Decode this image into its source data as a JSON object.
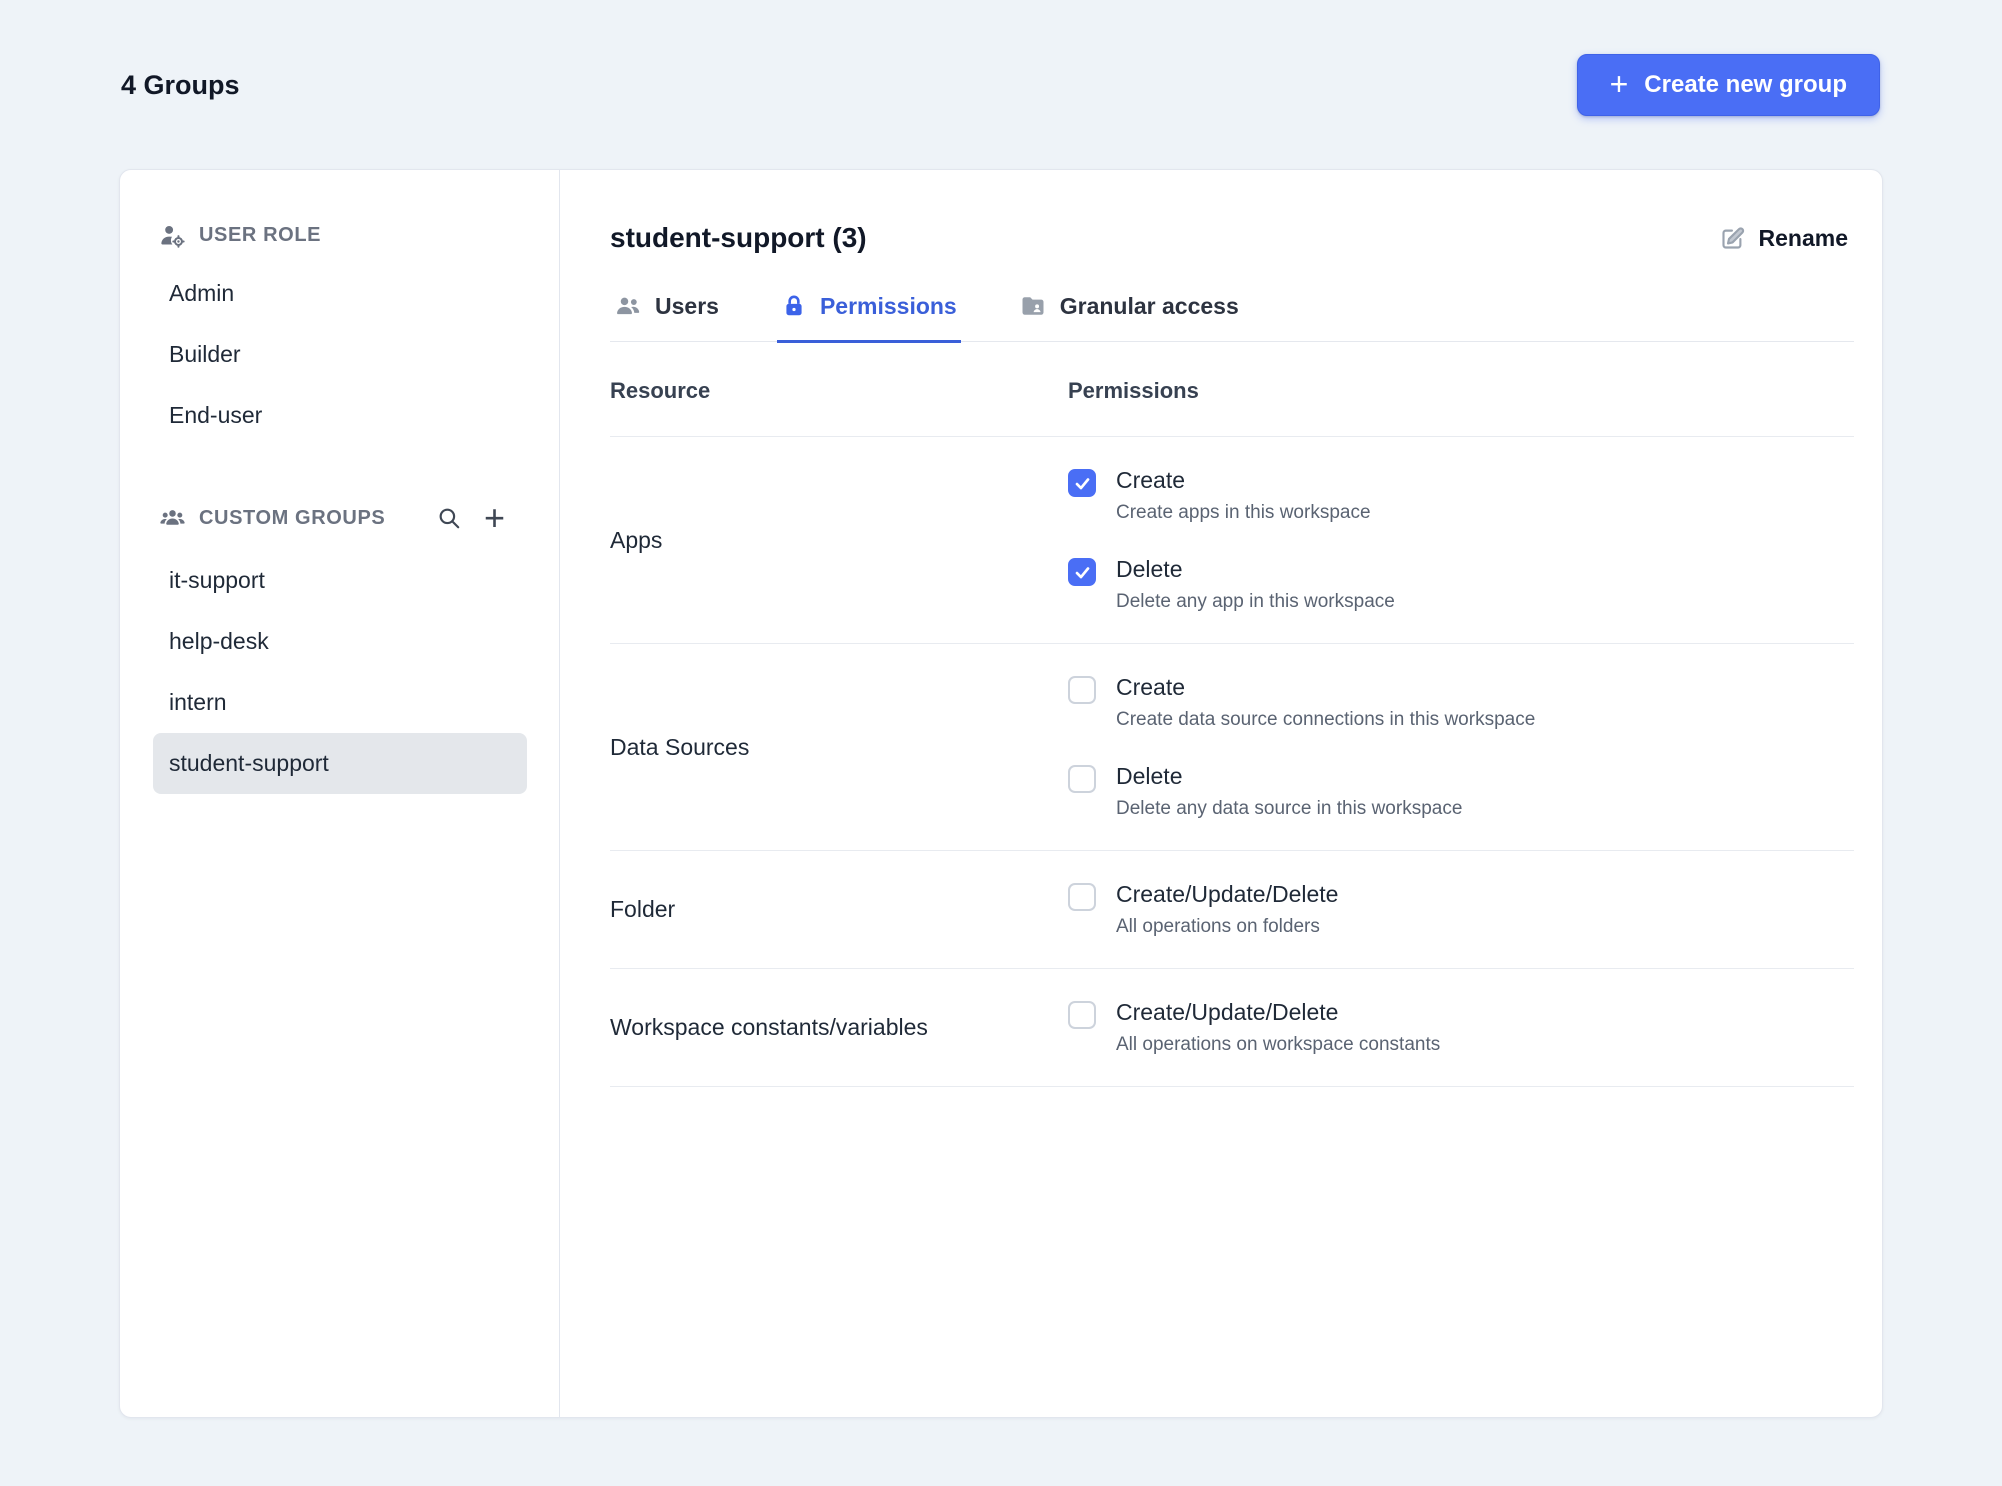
{
  "page": {
    "groups_label": "4 Groups",
    "create_button": "Create new group"
  },
  "icons": {
    "plus": "+"
  },
  "colors": {
    "accent": "#4a6ef5",
    "tab_active": "#3a5fd9",
    "checkbox_checked": "#4a6ef5",
    "page_background": "#eef3f8",
    "selected_item_background": "#e4e7eb"
  },
  "sidebar": {
    "user_role": {
      "title": "USER ROLE",
      "items": [
        {
          "label": "Admin"
        },
        {
          "label": "Builder"
        },
        {
          "label": "End-user"
        }
      ]
    },
    "custom_groups": {
      "title": "CUSTOM GROUPS",
      "items": [
        {
          "label": "it-support",
          "selected": false
        },
        {
          "label": "help-desk",
          "selected": false
        },
        {
          "label": "intern",
          "selected": false
        },
        {
          "label": "student-support",
          "selected": true
        }
      ]
    }
  },
  "main": {
    "title": "student-support (3)",
    "rename": "Rename",
    "tabs": [
      {
        "label": "Users",
        "active": false
      },
      {
        "label": "Permissions",
        "active": true
      },
      {
        "label": "Granular access",
        "active": false
      }
    ],
    "table": {
      "header": {
        "resource": "Resource",
        "permissions": "Permissions"
      },
      "rows": [
        {
          "resource": "Apps",
          "permissions": [
            {
              "label": "Create",
              "description": "Create apps in this workspace",
              "checked": true
            },
            {
              "label": "Delete",
              "description": "Delete any app in this workspace",
              "checked": true
            }
          ]
        },
        {
          "resource": "Data Sources",
          "permissions": [
            {
              "label": "Create",
              "description": "Create data source connections in this workspace",
              "checked": false
            },
            {
              "label": "Delete",
              "description": "Delete any data source in this workspace",
              "checked": false
            }
          ]
        },
        {
          "resource": "Folder",
          "permissions": [
            {
              "label": "Create/Update/Delete",
              "description": "All operations on folders",
              "checked": false
            }
          ]
        },
        {
          "resource": "Workspace constants/variables",
          "permissions": [
            {
              "label": "Create/Update/Delete",
              "description": "All operations on workspace constants",
              "checked": false
            }
          ]
        }
      ]
    }
  }
}
